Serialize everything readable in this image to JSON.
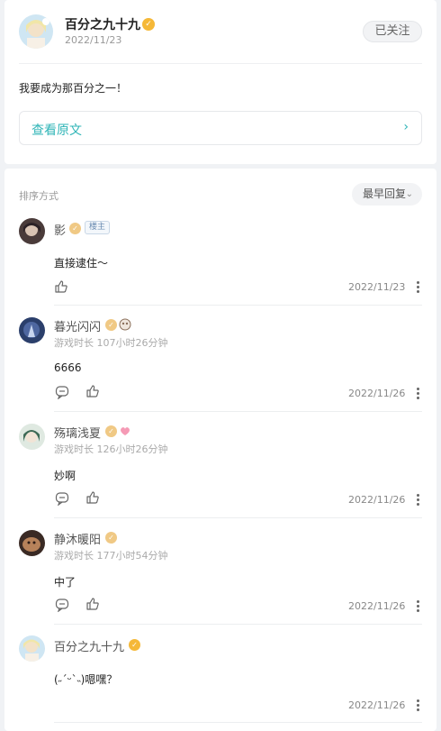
{
  "post": {
    "author_name": "百分之九十九",
    "date": "2022/11/23",
    "follow_label": "已关注",
    "text": "我要成为那百分之一！",
    "view_original_label": "查看原文"
  },
  "comments_section": {
    "sort_label": "排序方式",
    "sort_value": "最早回复"
  },
  "comments": [
    {
      "name": "影",
      "tag": "楼主",
      "playtime": "",
      "text": "直接逮住～",
      "date": "2022/11/23"
    },
    {
      "name": "暮光闪闪",
      "tag": "",
      "playtime": "游戏时长 107小时26分钟",
      "text": "6666",
      "date": "2022/11/26"
    },
    {
      "name": "殇璃浅夏",
      "tag": "",
      "playtime": "游戏时长 126小时26分钟",
      "text": "妙啊",
      "date": "2022/11/26"
    },
    {
      "name": "静沐暖阳",
      "tag": "",
      "playtime": "游戏时长 177小时54分钟",
      "text": "中了",
      "date": "2022/11/26"
    },
    {
      "name": "百分之九十九",
      "tag": "",
      "playtime": "",
      "text": "(˶ˊᵕˋ˵)嗯嘿？",
      "date": "2022/11/26"
    }
  ],
  "colors": {
    "accent": "#2fb5b7",
    "badge": "#f5b838"
  }
}
